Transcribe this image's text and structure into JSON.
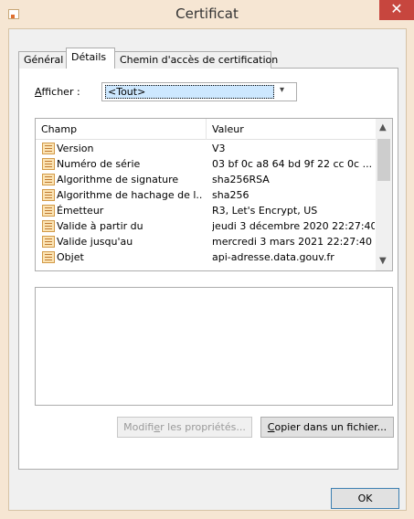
{
  "window": {
    "title": "Certificat",
    "close_glyph": "✕"
  },
  "tabs": [
    {
      "label": "Général"
    },
    {
      "label": "Détails"
    },
    {
      "label": "Chemin d'accès de certification"
    }
  ],
  "afficher": {
    "label_prefix": "A",
    "label_rest": "fficher :",
    "selected": "<Tout>"
  },
  "table": {
    "headers": {
      "field": "Champ",
      "value": "Valeur"
    },
    "rows": [
      {
        "field": "Version",
        "value": "V3"
      },
      {
        "field": "Numéro de série",
        "value": "03 bf 0c a8 64 bd 9f 22 cc 0c ..."
      },
      {
        "field": "Algorithme de signature",
        "value": "sha256RSA"
      },
      {
        "field": "Algorithme de hachage de l...",
        "value": "sha256"
      },
      {
        "field": "Émetteur",
        "value": "R3, Let's Encrypt, US"
      },
      {
        "field": "Valide à partir du",
        "value": "jeudi 3 décembre 2020 22:27:40"
      },
      {
        "field": "Valide jusqu'au",
        "value": "mercredi 3 mars 2021 22:27:40"
      },
      {
        "field": "Objet",
        "value": "api-adresse.data.gouv.fr"
      }
    ]
  },
  "buttons": {
    "modify_a": "Modifi",
    "modify_u": "e",
    "modify_b": "r les propriétés...",
    "copy_u": "C",
    "copy_rest": "opier dans un fichier...",
    "ok": "OK"
  },
  "icons": {
    "field_icon": "certificate-field-icon",
    "arrow_down": "▾",
    "scroll_up": "▲",
    "scroll_down": "▼"
  }
}
